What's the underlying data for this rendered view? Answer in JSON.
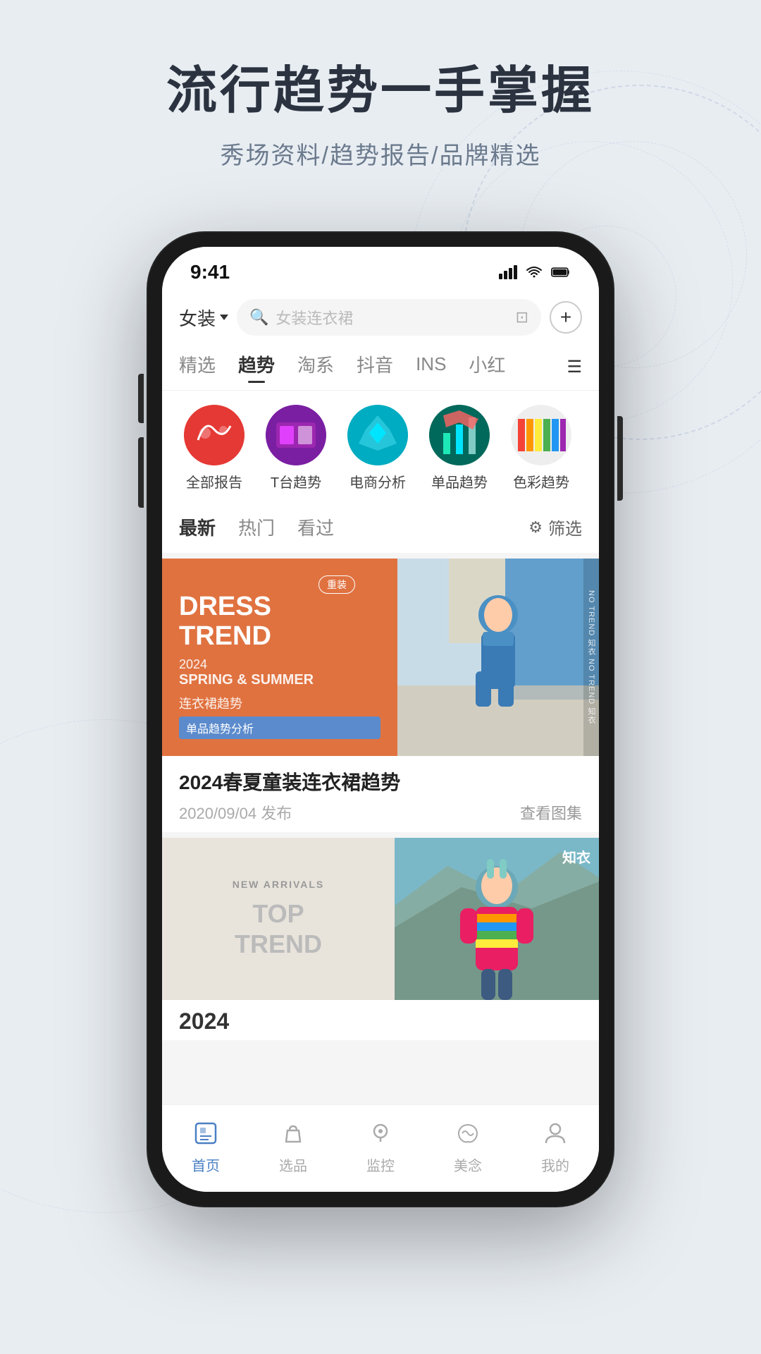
{
  "background": {
    "color": "#e8edf2"
  },
  "header": {
    "title": "流行趋势一手掌握",
    "subtitle": "秀场资料/趋势报告/品牌精选"
  },
  "phone": {
    "statusBar": {
      "time": "9:41"
    },
    "topNav": {
      "category": "女装",
      "searchPlaceholder": "女装连衣裙"
    },
    "tabs": [
      {
        "label": "精选",
        "active": false
      },
      {
        "label": "趋势",
        "active": true
      },
      {
        "label": "淘系",
        "active": false
      },
      {
        "label": "抖音",
        "active": false
      },
      {
        "label": "INS",
        "active": false
      },
      {
        "label": "小红",
        "active": false
      }
    ],
    "categories": [
      {
        "label": "全部报告",
        "colorClass": "cat-bg-1"
      },
      {
        "label": "T台趋势",
        "colorClass": "cat-bg-2"
      },
      {
        "label": "电商分析",
        "colorClass": "cat-bg-3"
      },
      {
        "label": "单品趋势",
        "colorClass": "cat-bg-4"
      },
      {
        "label": "色彩趋势",
        "colorClass": "cat-bg-5"
      }
    ],
    "filterTabs": [
      {
        "label": "最新",
        "active": true
      },
      {
        "label": "热门",
        "active": false
      },
      {
        "label": "看过",
        "active": false
      }
    ],
    "filterLabel": "筛选",
    "card1": {
      "leftTitle1": "DRESS",
      "leftTitle2": "TREND",
      "leftYear": "2024",
      "leftSeason": "SPRING & SUMMER",
      "leftSubtitle": "连衣裙趋势",
      "leftTag": "单品趋势分析",
      "leftBadge": "重装",
      "cardTitle": "2024春夏童装连衣裙趋势",
      "cardDate": "2020/09/04 发布",
      "cardAction": "查看图集",
      "sideTexts": [
        "NO TREND",
        "知衣",
        "NO TREND",
        "知衣"
      ]
    },
    "card2": {
      "newArrivals": "NEW ARRIVALS",
      "topTrend1": "TOP",
      "topTrend2": "TREND",
      "zhiyiBadge": "知衣",
      "yearLabel": "2024"
    },
    "bottomNav": [
      {
        "label": "首页",
        "active": true,
        "icon": "home"
      },
      {
        "label": "选品",
        "active": false,
        "icon": "bag"
      },
      {
        "label": "监控",
        "active": false,
        "icon": "monitor"
      },
      {
        "label": "美念",
        "active": false,
        "icon": "aesthetic"
      },
      {
        "label": "我的",
        "active": false,
        "icon": "profile"
      }
    ]
  }
}
